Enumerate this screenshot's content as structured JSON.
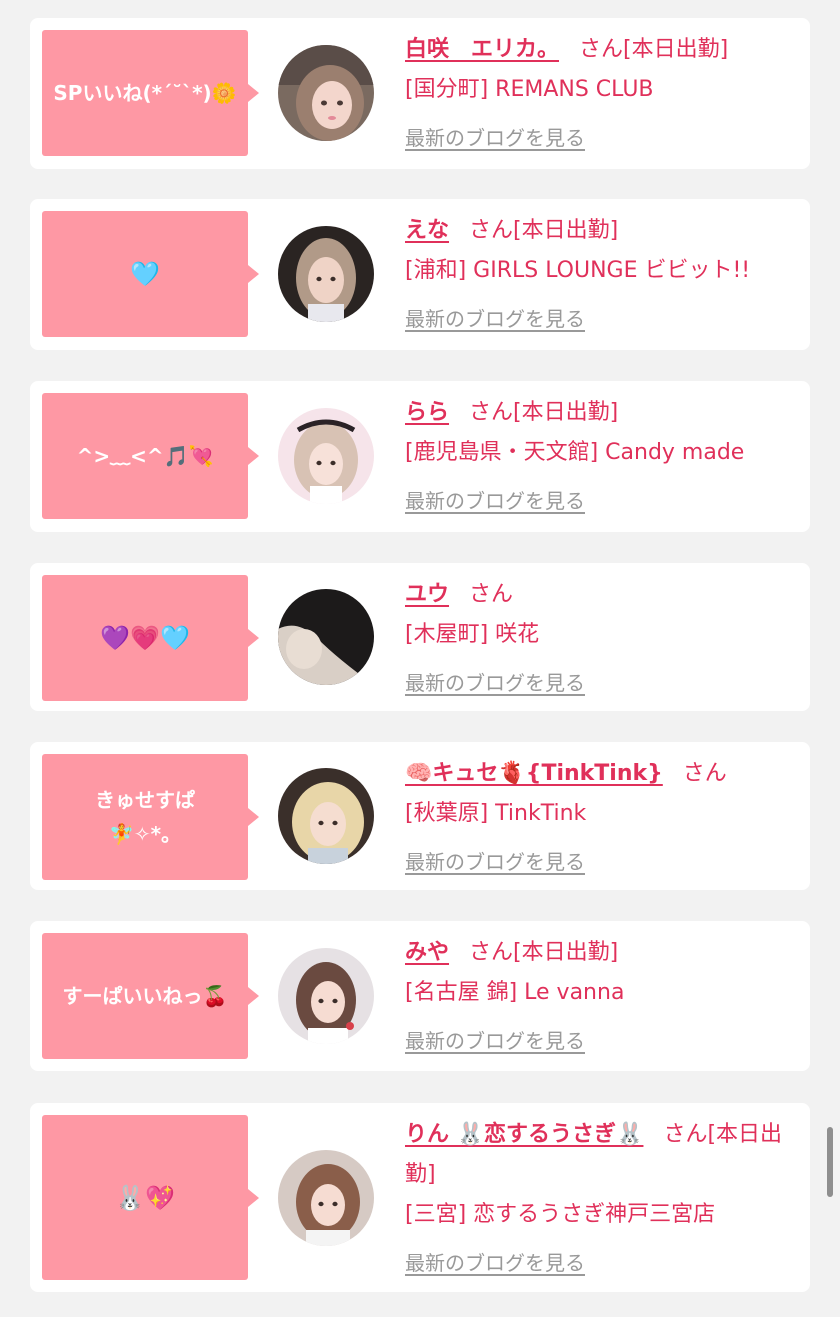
{
  "cards": [
    {
      "message": "SPいいね(*´˘`*)🌼",
      "name": "白咲　エリカ。",
      "honorific": "さん",
      "status": "[本日出勤]",
      "store": "[国分町] REMANS CLUB",
      "blog_link": "最新のブログを見る"
    },
    {
      "message": "🩵",
      "name": "えな",
      "honorific": "さん",
      "status": "[本日出勤]",
      "store": "[浦和] GIRLS LOUNGE ビビット!!",
      "blog_link": "最新のブログを見る"
    },
    {
      "message": "^>﹏<^🎵💘",
      "name": "らら",
      "honorific": "さん",
      "status": "[本日出勤]",
      "store": "[鹿児島県・天文館] Candy made",
      "blog_link": "最新のブログを見る"
    },
    {
      "message": "💜💗🩵",
      "name": "ユウ",
      "honorific": "さん",
      "status": "",
      "store": "[木屋町] 咲花",
      "blog_link": "最新のブログを見る"
    },
    {
      "message_line1": "きゅせすぱ",
      "message_line2": "🧚✧*。",
      "name": "🧠キュセ🫀{TinkTink}",
      "honorific": "さん",
      "status": "",
      "store": "[秋葉原] TinkTink",
      "blog_link": "最新のブログを見る"
    },
    {
      "message": "すーぱいいねっ🍒",
      "name": "みや",
      "honorific": "さん",
      "status": "[本日出勤]",
      "store": "[名古屋 錦] Le vanna",
      "blog_link": "最新のブログを見る"
    },
    {
      "message": "🐰💖",
      "name": "りん 🐰恋するうさぎ🐰",
      "honorific": "さん",
      "status": "[本日出勤]",
      "store": "[三宮] 恋するうさぎ神戸三宮店",
      "blog_link": "最新のブログを見る"
    }
  ],
  "colors": {
    "bubble": "#fe98a4",
    "accent": "#e0305a",
    "link_gray": "#999999",
    "background": "#f2f2f2"
  }
}
